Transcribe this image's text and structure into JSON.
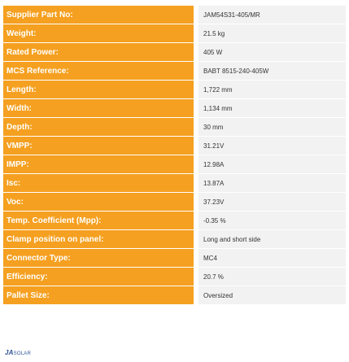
{
  "specs": [
    {
      "label": "Supplier Part No:",
      "value": "JAM54S31-405/MR"
    },
    {
      "label": "Weight:",
      "value": "21.5 kg"
    },
    {
      "label": "Rated Power:",
      "value": "405 W"
    },
    {
      "label": "MCS Reference:",
      "value": "BABT 8515-240-405W"
    },
    {
      "label": "Length:",
      "value": "1,722 mm"
    },
    {
      "label": "Width:",
      "value": "1,134 mm"
    },
    {
      "label": "Depth:",
      "value": "30 mm"
    },
    {
      "label": "VMPP:",
      "value": "31.21V"
    },
    {
      "label": "IMPP:",
      "value": "12.98A"
    },
    {
      "label": "Isc:",
      "value": "13.87A"
    },
    {
      "label": "Voc:",
      "value": "37.23V"
    },
    {
      "label": "Temp. Coefficient (Mpp):",
      "value": "-0.35 %"
    },
    {
      "label": "Clamp position on panel:",
      "value": "Long and short side"
    },
    {
      "label": "Connector Type:",
      "value": "MC4"
    },
    {
      "label": "Efficiency:",
      "value": "20.7 %"
    },
    {
      "label": "Pallet Size:",
      "value": "Oversized"
    }
  ],
  "logo": {
    "brand": "JA",
    "suffix": "SOLAR"
  },
  "colors": {
    "label_bg": "#f5a020",
    "value_bg": "#f2f2f2",
    "logo": "#2f5597"
  }
}
